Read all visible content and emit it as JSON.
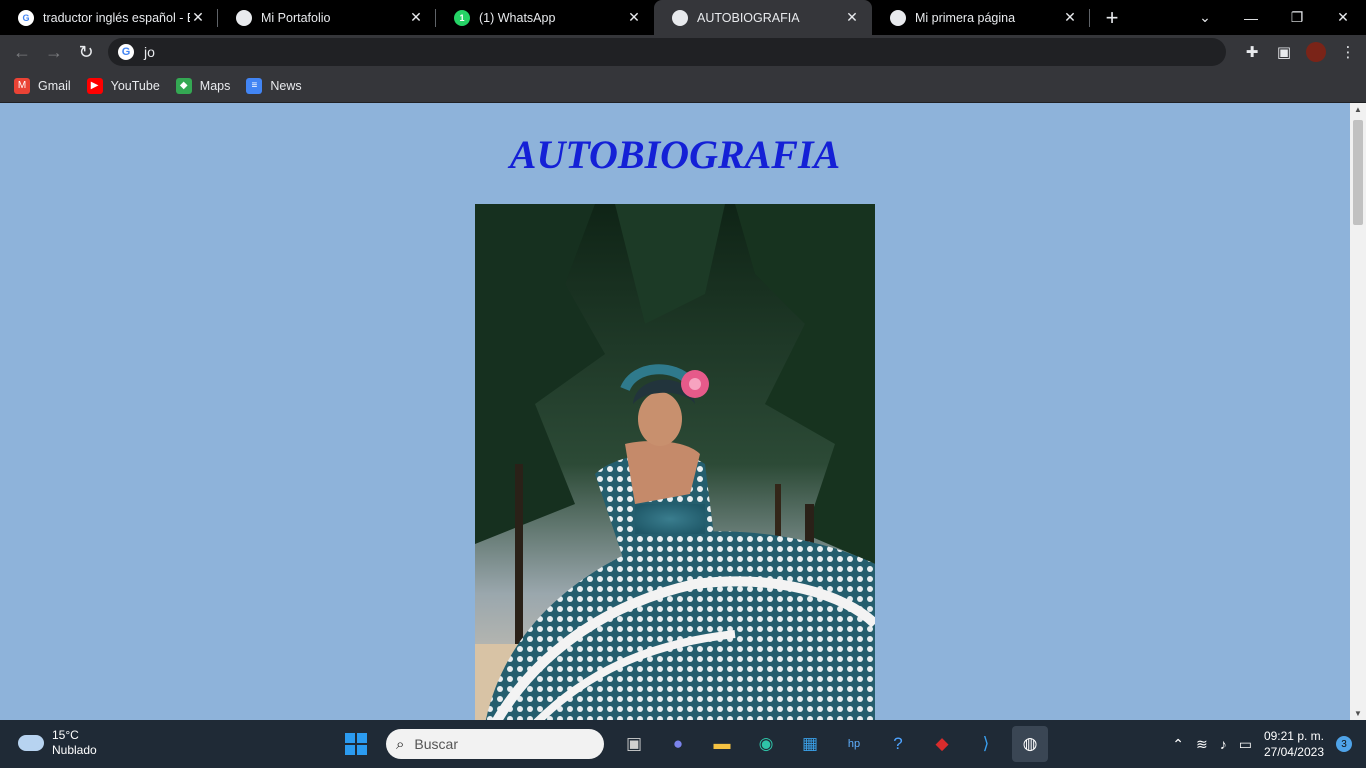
{
  "browser": {
    "tabs": [
      {
        "title": "traductor inglés español - Bu",
        "favicon": "google-icon",
        "active": false
      },
      {
        "title": "Mi Portafolio",
        "favicon": "globe-icon",
        "active": false
      },
      {
        "title": "(1) WhatsApp",
        "favicon": "whatsapp-icon",
        "active": false
      },
      {
        "title": "AUTOBIOGRAFIA",
        "favicon": "globe-icon",
        "active": true
      },
      {
        "title": "Mi primera página",
        "favicon": "globe-icon",
        "active": false
      }
    ],
    "omnibox_value": "jo",
    "bookmarks": [
      {
        "label": "Gmail",
        "icon": "gmail-icon"
      },
      {
        "label": "YouTube",
        "icon": "youtube-icon"
      },
      {
        "label": "Maps",
        "icon": "maps-icon"
      },
      {
        "label": "News",
        "icon": "news-icon"
      }
    ]
  },
  "page": {
    "title": "AUTOBIOGRAFIA",
    "background_color": "#8eb3da",
    "title_color": "#1420d6"
  },
  "taskbar": {
    "weather_temp": "15°C",
    "weather_desc": "Nublado",
    "search_placeholder": "Buscar",
    "time": "09:21 p. m.",
    "date": "27/04/2023",
    "notification_count": "3"
  }
}
